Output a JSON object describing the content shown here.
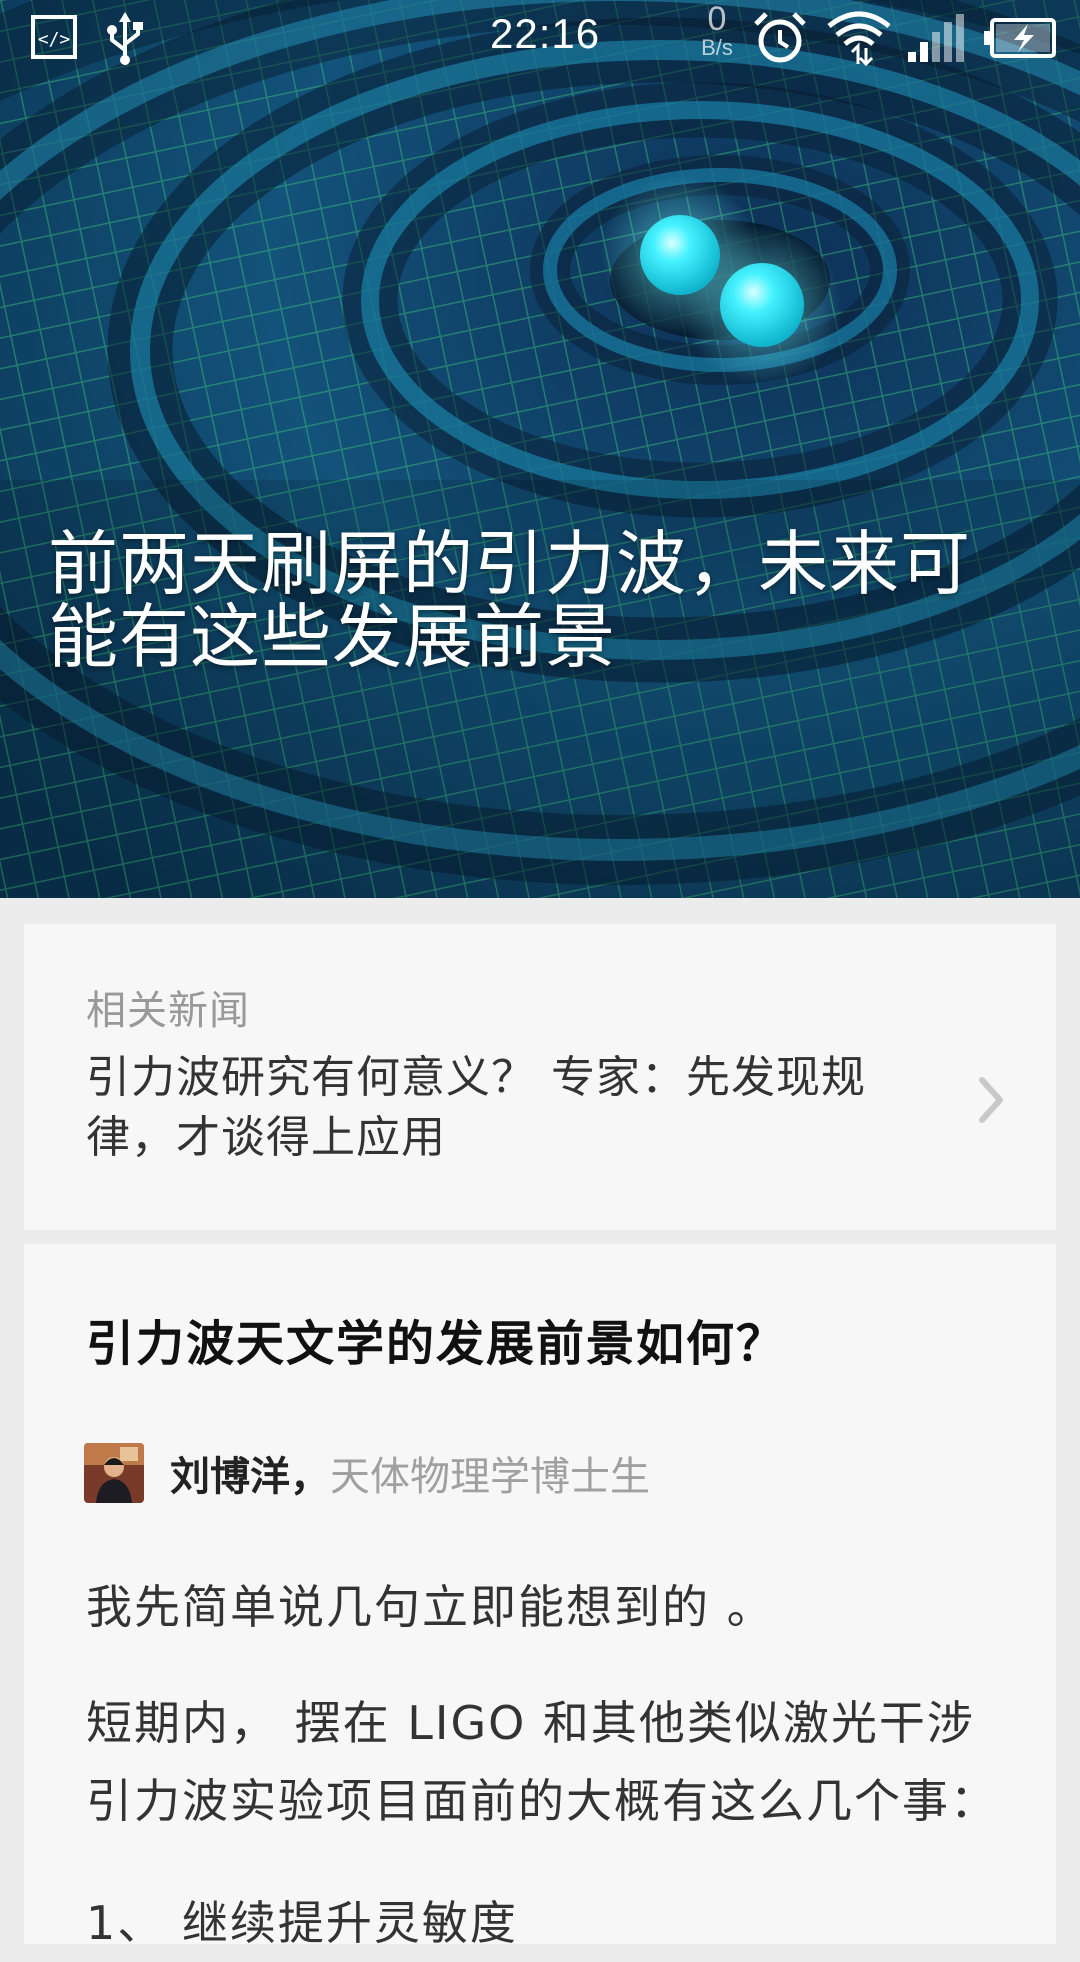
{
  "status_bar": {
    "time": "22:16",
    "net_speed_value": "0",
    "net_speed_unit": "B/s",
    "icons": [
      "dev-mode-icon",
      "usb-icon",
      "alarm-icon",
      "wifi-icon",
      "signal-icon",
      "battery-charging-icon"
    ]
  },
  "hero": {
    "title": "前两天刷屏的引力波，未来可能有这些发展前景"
  },
  "related": {
    "label": "相关新闻",
    "link_text": "引力波研究有何意义？ 专家：先发现规律，才谈得上应用"
  },
  "answer": {
    "question": "引力波天文学的发展前景如何？",
    "author_name": "刘博洋",
    "author_separator": "，",
    "author_title": "天体物理学博士生",
    "paragraphs": [
      "我先简单说几句立即能想到的 。",
      "短期内， 摆在 LIGO 和其他类似激光干涉引力波实验项目面前的大概有这么几个事：",
      "1、 继续提升灵敏度"
    ]
  },
  "colors": {
    "hero_bg": "#0a2c4a",
    "grid_green": "#3fd07a",
    "sphere_cyan": "#29e6f2",
    "card_bg": "#f7f7f7",
    "page_bg": "#ececec",
    "muted_text": "#999999"
  }
}
